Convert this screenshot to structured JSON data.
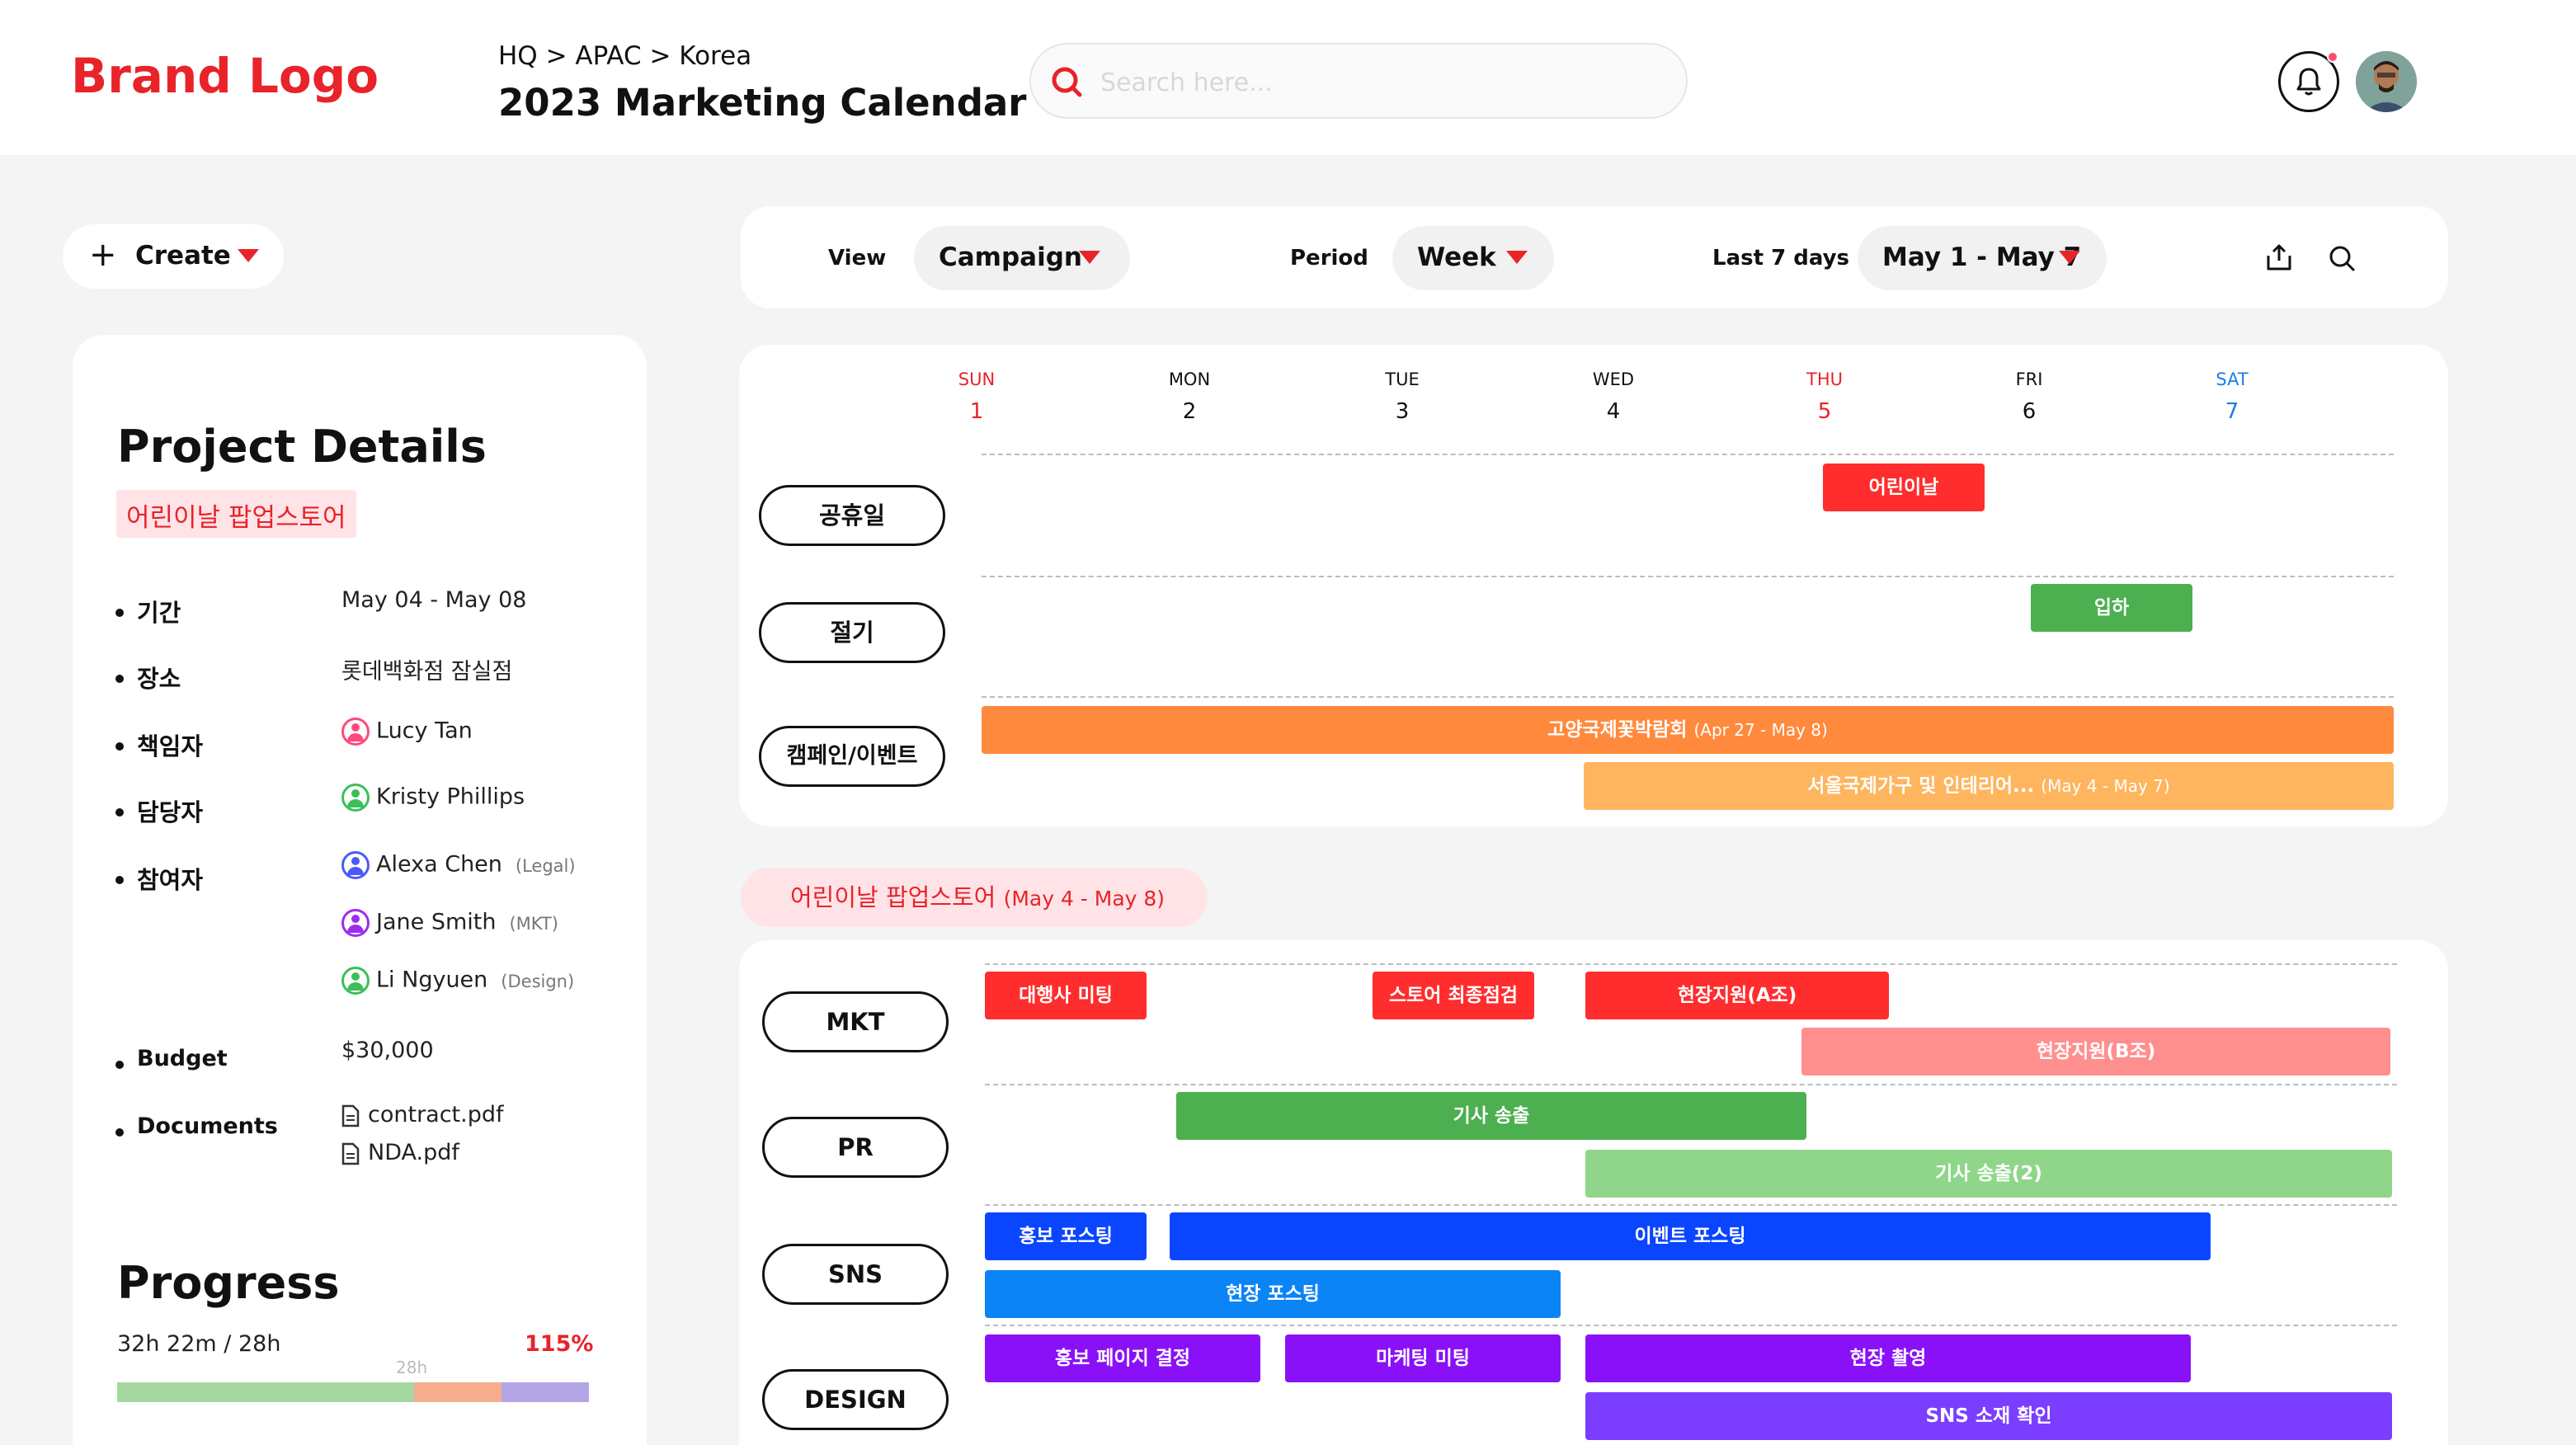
{
  "brand": "Brand Logo",
  "breadcrumb": "HQ > APAC > Korea",
  "title": "2023 Marketing Calendar",
  "search": {
    "placeholder": "Search here..."
  },
  "create": {
    "label": "Create"
  },
  "filters": {
    "view_label": "View",
    "view_value": "Campaign",
    "period_label": "Period",
    "period_value": "Week",
    "range_label": "Last 7 days",
    "range_value": "May 1 - May 7"
  },
  "days": [
    {
      "name": "SUN",
      "num": "1",
      "color": "#e8232a"
    },
    {
      "name": "MON",
      "num": "2",
      "color": "#111111"
    },
    {
      "name": "TUE",
      "num": "3",
      "color": "#111111"
    },
    {
      "name": "WED",
      "num": "4",
      "color": "#111111"
    },
    {
      "name": "THU",
      "num": "5",
      "color": "#e8232a"
    },
    {
      "name": "FRI",
      "num": "6",
      "color": "#111111"
    },
    {
      "name": "SAT",
      "num": "7",
      "color": "#1a7de8"
    }
  ],
  "details": {
    "heading": "Project Details",
    "project": "어린이날 팝업스토어",
    "period_key": "기간",
    "period_val": "May 04 - May 08",
    "place_key": "장소",
    "place_val": "롯데백화점 잠실점",
    "owner_key": "책임자",
    "owner_val": "Lucy Tan",
    "manager_key": "담당자",
    "manager_val": "Kristy Phillips",
    "members_key": "참여자",
    "members": [
      {
        "name": "Alexa Chen",
        "role": "(Legal)"
      },
      {
        "name": "Jane Smith",
        "role": "(MKT)"
      },
      {
        "name": "Li Ngyuen",
        "role": "(Design)"
      }
    ],
    "budget_key": "Budget",
    "budget_val": "$30,000",
    "docs_key": "Documents",
    "docs": [
      "contract.pdf",
      "NDA.pdf"
    ]
  },
  "progress": {
    "heading": "Progress",
    "time": "32h 22m / 28h",
    "percent": "115%",
    "marker": "28h"
  },
  "top_rows": [
    "공휴일",
    "절기",
    "캠페인/이벤트"
  ],
  "top_events": {
    "holiday": "어린이날",
    "season": "입하",
    "campaign1": "고양국제꽃박람회",
    "campaign1_range": "(Apr 27 - May 8)",
    "campaign2": "서울국제가구 및 인테리어...",
    "campaign2_range": "(May 4 - May 7)"
  },
  "phase": {
    "label": "어린이날 팝업스토어",
    "range": "(May 4 - May 8)"
  },
  "team_rows": [
    "MKT",
    "PR",
    "SNS",
    "DESIGN"
  ],
  "team_events": {
    "mkt1": "대행사 미팅",
    "mkt2": "스토어 최종점검",
    "mkt3": "현장지원(A조)",
    "mkt4": "현장지원(B조)",
    "pr1": "기사 송출",
    "pr2": "기사 송출(2)",
    "sns1": "홍보 포스팅",
    "sns2": "이벤트 포스팅",
    "sns3": "현장 포스팅",
    "des1": "홍보 페이지 결정",
    "des2": "마케팅 미팅",
    "des3": "현장 촬영",
    "des4": "SNS 소재 확인"
  },
  "colors": {
    "brand": "#e8232a",
    "red": "#ff2d2d",
    "light_red": "#ff8f8f",
    "green": "#4caf50",
    "light_green": "#8fd68a",
    "orange": "#ff8a3d",
    "light_orange": "#ffb55e",
    "blue": "#0a46ff",
    "sky": "#0b84f5",
    "purple": "#8a11f7",
    "violet": "#7b3dff"
  }
}
